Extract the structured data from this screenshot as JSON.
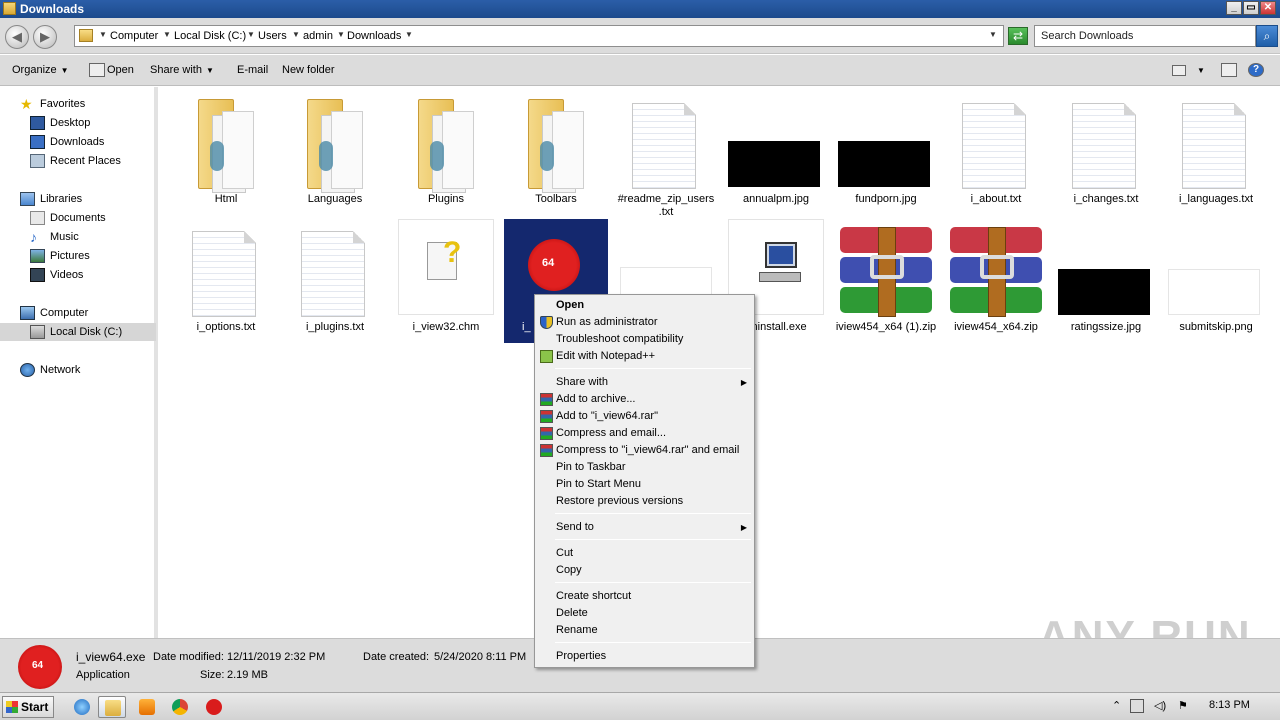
{
  "window": {
    "title": "Downloads",
    "controls": {
      "minimize": "_",
      "maximize": "▭",
      "close": "✕"
    }
  },
  "address": {
    "back": "◀",
    "forward": "▶",
    "crumbs": [
      "Computer",
      "Local Disk (C:)",
      "Users",
      "admin",
      "Downloads"
    ],
    "search_placeholder": "Search Downloads"
  },
  "toolbar": {
    "organize": "Organize",
    "open": "Open",
    "share_with": "Share with",
    "email": "E-mail",
    "new_folder": "New folder"
  },
  "nav": {
    "favorites": "Favorites",
    "desktop": "Desktop",
    "downloads": "Downloads",
    "recent": "Recent Places",
    "libraries": "Libraries",
    "documents": "Documents",
    "music": "Music",
    "pictures": "Pictures",
    "videos": "Videos",
    "computer": "Computer",
    "localdisk": "Local Disk (C:)",
    "network": "Network"
  },
  "files": {
    "html": "Html",
    "languages": "Languages",
    "plugins": "Plugins",
    "toolbars": "Toolbars",
    "readme": "#readme_zip_users .txt",
    "annualpm": "annualpm.jpg",
    "fundporn": "fundporn.jpg",
    "about": "i_about.txt",
    "changes": "i_changes.txt",
    "i_languages": "i_languages.txt",
    "options": "i_options.txt",
    "i_plugins": "i_plugins.txt",
    "view32": "i_view32.chm",
    "view64": "i_",
    "uninstall": "uninstall.exe",
    "zip1": "iview454_x64 (1).zip",
    "zip2": "iview454_x64.zip",
    "ratings": "ratingssize.jpg",
    "submitskip": "submitskip.png"
  },
  "context_menu": {
    "open": "Open",
    "run_admin": "Run as administrator",
    "troubleshoot": "Troubleshoot compatibility",
    "notepad": "Edit with Notepad++",
    "share_with": "Share with",
    "add_archive": "Add to archive...",
    "add_rar": "Add to \"i_view64.rar\"",
    "compress_email": "Compress and email...",
    "compress_rar_email": "Compress to \"i_view64.rar\" and email",
    "pin_taskbar": "Pin to Taskbar",
    "pin_start": "Pin to Start Menu",
    "restore": "Restore previous versions",
    "send_to": "Send to",
    "cut": "Cut",
    "copy": "Copy",
    "create_shortcut": "Create shortcut",
    "delete": "Delete",
    "rename": "Rename",
    "properties": "Properties"
  },
  "details": {
    "name": "i_view64.exe",
    "modified_label": "Date modified:",
    "modified": "12/11/2019 2:32 PM",
    "created_label": "Date created:",
    "created": "5/24/2020 8:11 PM",
    "type": "Application",
    "size_label": "Size:",
    "size": "2.19 MB",
    "icon_text": "64"
  },
  "watermark": "ANY RUN",
  "taskbar": {
    "start": "Start",
    "time": "8:13 PM"
  }
}
